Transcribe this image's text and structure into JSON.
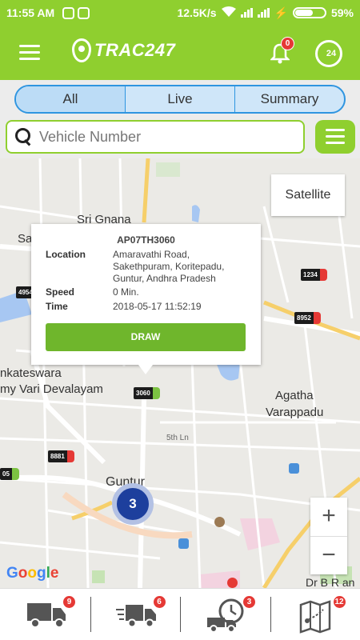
{
  "status_bar": {
    "time": "11:55 AM",
    "net_speed": "12.5K/s",
    "battery": "59%"
  },
  "header": {
    "logo_text": "TRAC247",
    "notification_count": "0",
    "support_label": "24"
  },
  "tabs": [
    {
      "label": "All",
      "active": true
    },
    {
      "label": "Live",
      "active": false
    },
    {
      "label": "Summary",
      "active": false
    }
  ],
  "search": {
    "placeholder": "Vehicle Number"
  },
  "map": {
    "satellite_label": "Satellite",
    "zoom_in": "+",
    "zoom_out": "−",
    "cluster_count": "3",
    "attribution": "Google",
    "labels": {
      "sri_gnana": "Sri Gnana",
      "sa": "Sa",
      "venkateswara": "nkateswara",
      "devalayam": "my Vari Devalayam",
      "guntur": "Guntur",
      "agatha": "Agatha",
      "varappadu": "Varappadu",
      "fifth_ln": "5th Ln",
      "dr_b_r": "Dr B R an"
    },
    "vehicles": [
      {
        "id": "t4954",
        "label": "4954",
        "status": "red"
      },
      {
        "id": "t1234",
        "label": "1234",
        "status": "red"
      },
      {
        "id": "t8952",
        "label": "8952",
        "status": "red"
      },
      {
        "id": "t3060",
        "label": "3060",
        "status": "green"
      },
      {
        "id": "t8881",
        "label": "8881",
        "status": "red"
      },
      {
        "id": "t05",
        "label": "05",
        "status": "green"
      }
    ],
    "colors": {
      "green_road": "#7cc242",
      "red_vehicle": "#e53935",
      "cluster": "#1d3f9d"
    }
  },
  "info_window": {
    "vehicle_number": "AP07TH3060",
    "location_label": "Location",
    "location_value": "Amaravathi Road, Sakethpuram, Koritepadu, Guntur, Andhra Pradesh",
    "speed_label": "Speed",
    "speed_value": "0 Min.",
    "time_label": "Time",
    "time_value": "2018-05-17 11:52:19",
    "draw_label": "DRAW"
  },
  "bottom_nav": [
    {
      "name": "all-vehicles",
      "icon": "truck-icon",
      "count": "9"
    },
    {
      "name": "moving-vehicles",
      "icon": "fast-truck-icon",
      "count": "6"
    },
    {
      "name": "idle-vehicles",
      "icon": "truck-clock-icon",
      "count": "3"
    },
    {
      "name": "route-map",
      "icon": "route-map-icon",
      "count": "12"
    }
  ],
  "theme": {
    "primary": "#8fcf2f",
    "tab_border": "#2f95e0",
    "badge": "#e53935"
  }
}
